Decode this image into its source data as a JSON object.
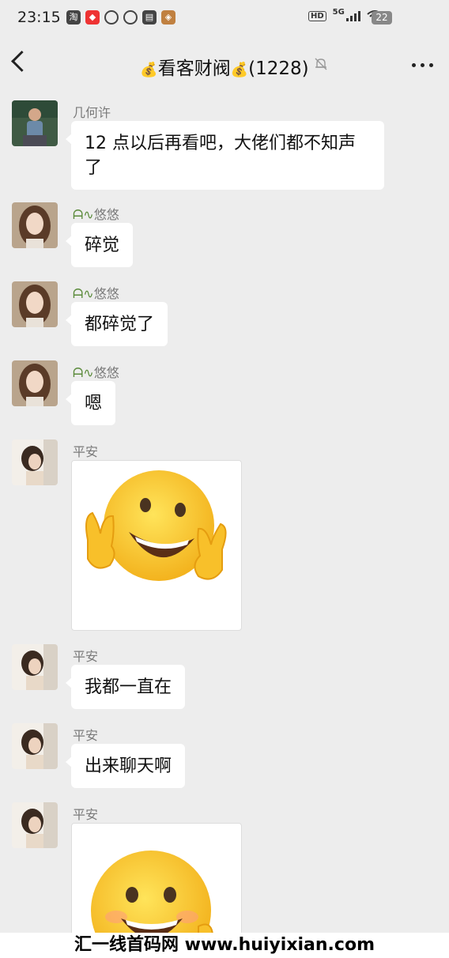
{
  "status": {
    "time": "23:15",
    "network": "5G",
    "battery": "22"
  },
  "header": {
    "title": "看客财阀",
    "member_count": "(1228)",
    "bag_emoji": "💰"
  },
  "messages": [
    {
      "sender": "几何许",
      "text": "12 点以后再看吧，大佬们都不知声了",
      "type": "text",
      "avatar": "man-photo"
    },
    {
      "sender": "悠悠",
      "sender_prefix": "ᗩ∿",
      "text": "碎觉",
      "type": "text",
      "avatar": "girl-portrait"
    },
    {
      "sender": "悠悠",
      "sender_prefix": "ᗩ∿",
      "text": "都碎觉了",
      "type": "text",
      "avatar": "girl-portrait"
    },
    {
      "sender": "悠悠",
      "sender_prefix": "ᗩ∿",
      "text": "嗯",
      "type": "text",
      "avatar": "girl-portrait"
    },
    {
      "sender": "平安",
      "type": "sticker",
      "sticker": "smiley-victory-emoji",
      "avatar": "woman-side-portrait"
    },
    {
      "sender": "平安",
      "text": "我都一直在",
      "type": "text",
      "avatar": "woman-side-portrait"
    },
    {
      "sender": "平安",
      "text": "出来聊天啊",
      "type": "text",
      "avatar": "woman-side-portrait"
    },
    {
      "sender": "平安",
      "type": "sticker",
      "sticker": "smiley-emoji",
      "avatar": "woman-side-portrait"
    }
  ],
  "watermark": {
    "text": "汇一线首码网  www.huiyixian.com"
  }
}
